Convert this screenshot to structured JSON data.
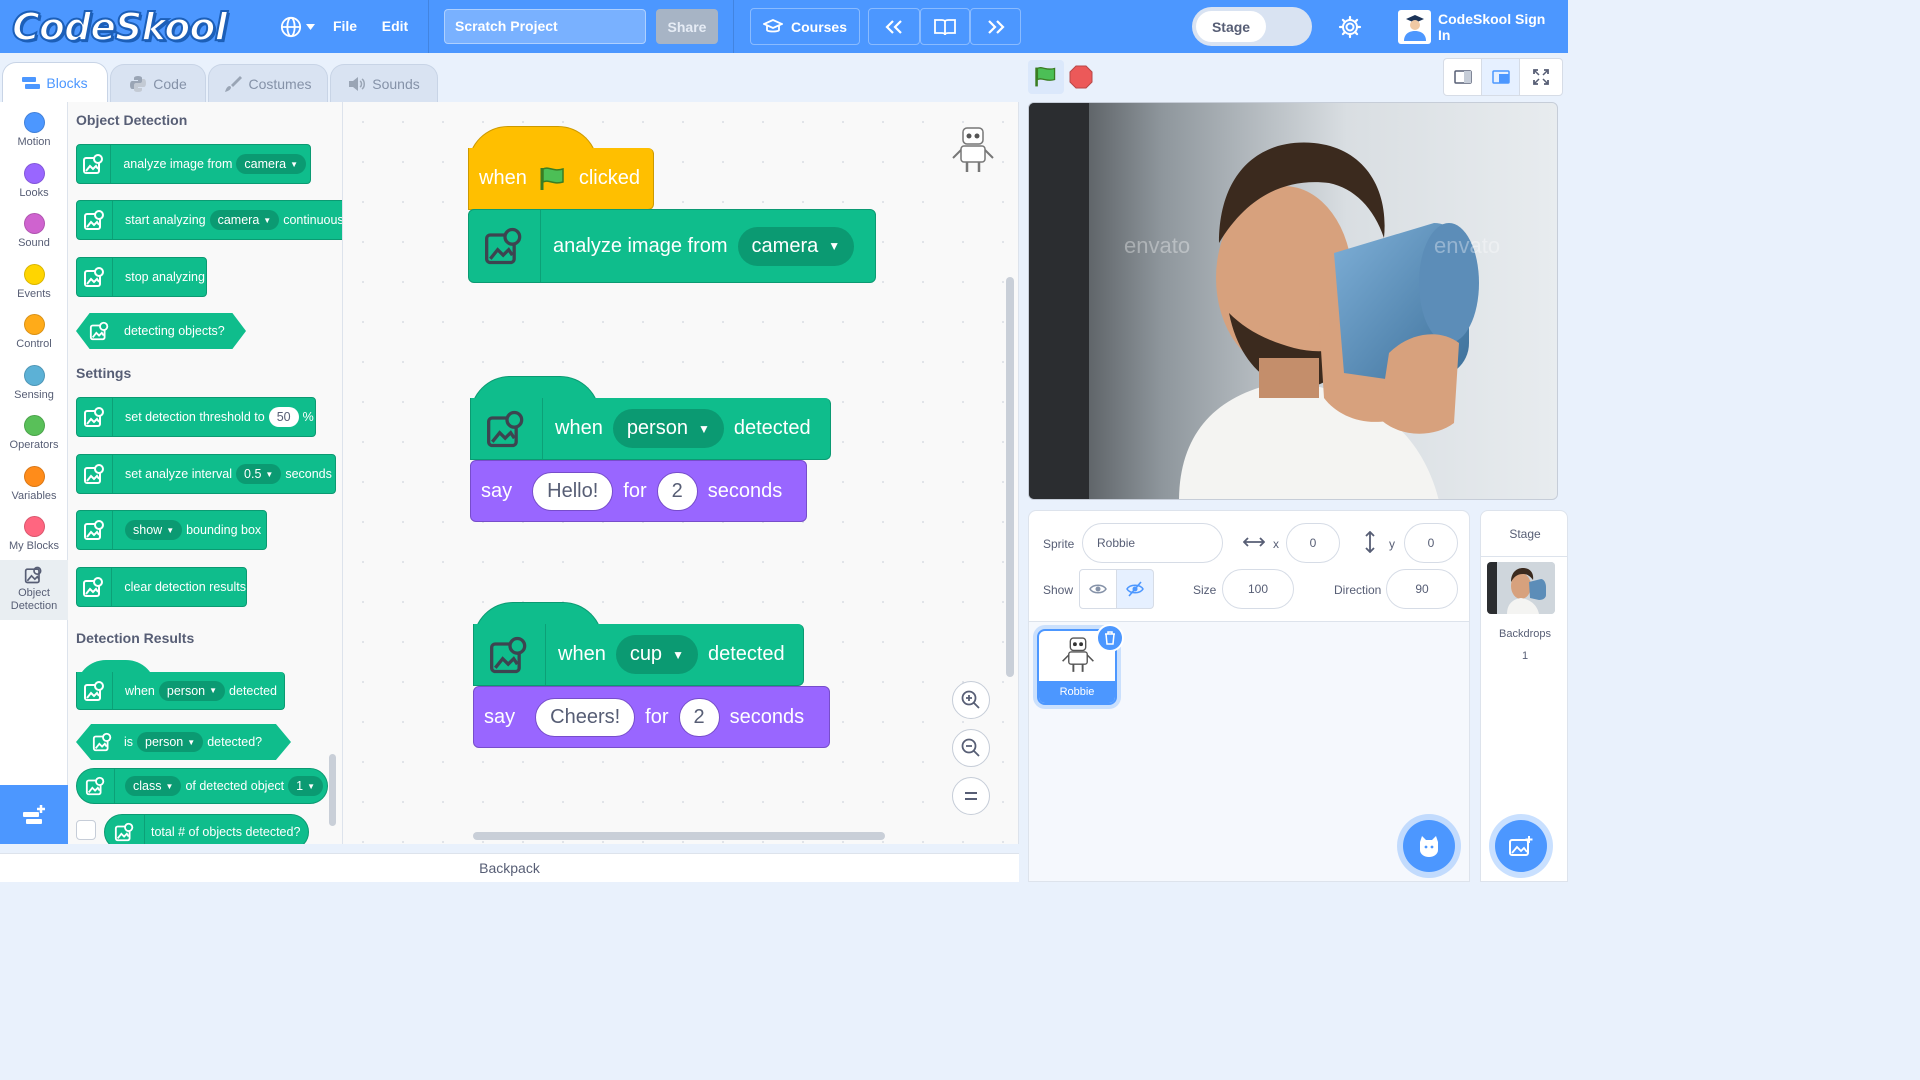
{
  "topbar": {
    "logo": "CodeSkool",
    "menu_file": "File",
    "menu_edit": "Edit",
    "project_title": "Scratch Project",
    "share_label": "Share",
    "courses_label": "Courses",
    "stage_toggle_label": "Stage",
    "signin_label": "CodeSkool Sign In"
  },
  "tabs": [
    {
      "label": "Blocks"
    },
    {
      "label": "Code"
    },
    {
      "label": "Costumes"
    },
    {
      "label": "Sounds"
    }
  ],
  "categories": [
    {
      "label": "Motion",
      "color": "#4c97ff"
    },
    {
      "label": "Looks",
      "color": "#9966ff"
    },
    {
      "label": "Sound",
      "color": "#cf63cf"
    },
    {
      "label": "Events",
      "color": "#ffd500"
    },
    {
      "label": "Control",
      "color": "#ffab19"
    },
    {
      "label": "Sensing",
      "color": "#5cb1d6"
    },
    {
      "label": "Operators",
      "color": "#59c059"
    },
    {
      "label": "Variables",
      "color": "#ff8c1a"
    },
    {
      "label": "My Blocks",
      "color": "#ff6680"
    },
    {
      "label": "Object Detection",
      "color": "#0fbd8c"
    }
  ],
  "palette": {
    "section_object": "Object Detection",
    "b_analyze": "analyze image from",
    "b_analyze_dd": "camera",
    "b_start": "start analyzing",
    "b_start_dd": "camera",
    "b_start_tail": "continuous",
    "b_stop": "stop analyzing",
    "b_detecting": "detecting objects?",
    "section_settings": "Settings",
    "b_threshold": "set detection threshold to",
    "b_threshold_val": "50",
    "b_threshold_unit": "%",
    "b_interval": "set analyze interval",
    "b_interval_dd": "0.5",
    "b_interval_unit": "seconds",
    "b_show_dd": "show",
    "b_show_tail": "bounding box",
    "b_clear": "clear detection results",
    "section_results": "Detection Results",
    "b_when": "when",
    "b_when_dd": "person",
    "b_when_tail": "detected",
    "b_is": "is",
    "b_is_dd": "person",
    "b_is_tail": "detected?",
    "b_class_dd": "class",
    "b_class_mid": "of detected object",
    "b_class_num": "1",
    "b_total": "total # of objects detected?"
  },
  "workspace": {
    "s1_when": "when",
    "s1_clicked": "clicked",
    "s1_analyze": "analyze image from",
    "s1_analyze_dd": "camera",
    "s2_when": "when",
    "s2_dd": "person",
    "s2_detected": "detected",
    "s2_say": "say",
    "s2_msg": "Hello!",
    "s2_for": "for",
    "s2_secs": "2",
    "s2_seconds": "seconds",
    "s3_when": "when",
    "s3_dd": "cup",
    "s3_detected": "detected",
    "s3_say": "say",
    "s3_msg": "Cheers!",
    "s3_for": "for",
    "s3_secs": "2",
    "s3_seconds": "seconds"
  },
  "backpack_label": "Backpack",
  "sprite_info": {
    "sprite_label": "Sprite",
    "sprite_name": "Robbie",
    "x_label": "x",
    "x_value": "0",
    "y_label": "y",
    "y_value": "0",
    "show_label": "Show",
    "size_label": "Size",
    "size_value": "100",
    "direction_label": "Direction",
    "direction_value": "90"
  },
  "sprite_tile_name": "Robbie",
  "stage_panel": {
    "title": "Stage",
    "backdrops_label": "Backdrops",
    "backdrops_count": "1"
  },
  "stage_watermark": "envato"
}
